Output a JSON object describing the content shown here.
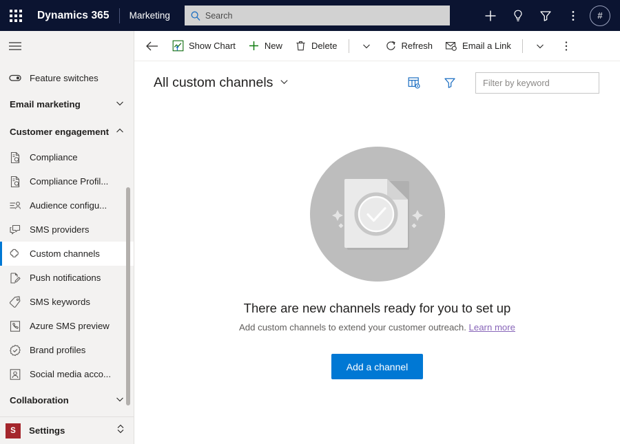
{
  "topbar": {
    "waffle_icon": "waffle-grid-icon",
    "brand": "Dynamics 365",
    "app_name": "Marketing",
    "search": {
      "placeholder": "Search",
      "value": "",
      "icon": "search-icon"
    },
    "icons": [
      {
        "name": "add-icon",
        "glyph": "plus"
      },
      {
        "name": "lightbulb-icon",
        "glyph": "lightbulb"
      },
      {
        "name": "filter-icon",
        "glyph": "funnel"
      },
      {
        "name": "more-icon",
        "glyph": "vertical-dots"
      }
    ],
    "avatar_label": "#"
  },
  "sidebar": {
    "hamburger_icon": "hamburger-menu-icon",
    "feature_switches": {
      "label": "Feature switches",
      "icon": "toggle-icon"
    },
    "groups": [
      {
        "label": "Email marketing",
        "expanded": false,
        "chevron": "chevron-down-icon"
      },
      {
        "label": "Customer engagement",
        "expanded": true,
        "chevron": "chevron-up-icon"
      },
      {
        "label": "Collaboration",
        "expanded": false,
        "chevron": "chevron-down-icon"
      }
    ],
    "items": [
      {
        "label": "Compliance",
        "icon": "document-search-icon",
        "selected": false
      },
      {
        "label": "Compliance Profil...",
        "icon": "document-search-icon",
        "selected": false
      },
      {
        "label": "Audience configu...",
        "icon": "audience-person-icon",
        "selected": false
      },
      {
        "label": "SMS providers",
        "icon": "chat-bubbles-icon",
        "selected": false
      },
      {
        "label": "Custom channels",
        "icon": "puzzle-piece-icon",
        "selected": true
      },
      {
        "label": "Push notifications",
        "icon": "push-notification-icon",
        "selected": false
      },
      {
        "label": "SMS keywords",
        "icon": "tag-icon",
        "selected": false
      },
      {
        "label": "Azure SMS preview",
        "icon": "phone-device-icon",
        "selected": false
      },
      {
        "label": "Brand profiles",
        "icon": "badge-check-icon",
        "selected": false
      },
      {
        "label": "Social media acco...",
        "icon": "person-frame-icon",
        "selected": false
      }
    ],
    "settings": {
      "label": "Settings",
      "badge": "S",
      "badge_color": "#a4262c",
      "chevron": "chevron-updown-icon"
    },
    "selected_accent": "#0078d4"
  },
  "command_bar": {
    "back_icon": "back-arrow-icon",
    "buttons": [
      {
        "label": "Show Chart",
        "icon": "chart-icon"
      },
      {
        "label": "New",
        "icon": "plus-icon"
      },
      {
        "label": "Delete",
        "icon": "trash-icon"
      },
      {
        "label": "Refresh",
        "icon": "refresh-icon"
      },
      {
        "label": "Email a Link",
        "icon": "email-link-icon"
      }
    ],
    "overflow_icon": "more-vertical-icon",
    "chevron_icon": "chevron-down-icon"
  },
  "view_bar": {
    "title": "All custom channels",
    "title_chevron": "chevron-down-icon",
    "edit_columns_icon": "edit-columns-icon",
    "filter_icon": "filter-funnel-icon",
    "filter_input": {
      "placeholder": "Filter by keyword",
      "value": ""
    }
  },
  "empty_state": {
    "illustration": "document-checkmark-sparkle-illustration",
    "title": "There are new channels ready for you to set up",
    "subtitle": "Add custom channels to extend your customer outreach.",
    "link_label": "Learn more",
    "button_label": "Add a channel",
    "button_color": "#0078d4",
    "link_color": "#8764b8"
  }
}
